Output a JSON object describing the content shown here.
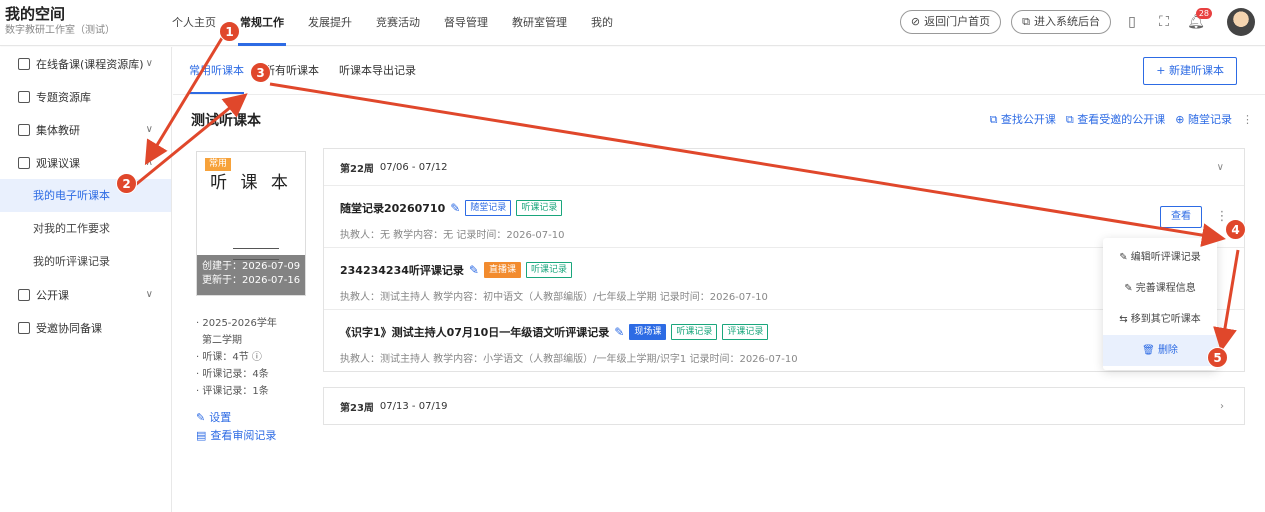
{
  "brand": {
    "title": "我的空间",
    "subtitle": "数字教研工作室（测试）"
  },
  "nav": [
    "个人主页",
    "常规工作",
    "发展提升",
    "竞赛活动",
    "督导管理",
    "教研室管理",
    "我的"
  ],
  "nav_active": "常规工作",
  "top_right": {
    "portal": "返回门户首页",
    "backend": "进入系统后台",
    "notif_count": "28"
  },
  "sidebar": {
    "items": [
      {
        "label": "在线备课(课程资源库)"
      },
      {
        "label": "专题资源库"
      },
      {
        "label": "集体教研"
      },
      {
        "label": "观课议课"
      }
    ],
    "sub": [
      "我的电子听课本",
      "对我的工作要求",
      "我的听评课记录"
    ],
    "items2": [
      {
        "label": "公开课"
      },
      {
        "label": "受邀协同备课"
      }
    ]
  },
  "tabs": [
    "常用听课本",
    "所有听课本",
    "听课本导出记录"
  ],
  "new_button": "+ 新建听课本",
  "book": {
    "title": "测试听课本",
    "tools": [
      "查找公开课",
      "查看受邀的公开课",
      "随堂记录"
    ],
    "cover": {
      "tag": "常用",
      "name": "听 课 本",
      "created": "创建于：2026-07-09",
      "updated": "更新于：2026-07-16"
    },
    "meta": [
      "· 2025-2026学年",
      "  第二学期",
      "· 听课：4节",
      "· 听课记录：4条",
      "· 评课记录：1条"
    ],
    "settings": "设置",
    "review": "查看审阅记录"
  },
  "weeks": [
    {
      "label": "第22周",
      "range": "07/06 - 07/12",
      "records": [
        {
          "title": "随堂记录20260710",
          "tags": [
            "随堂记录",
            "听课记录"
          ],
          "info": "执教人：无    教学内容：无    记录时间：2026-07-10"
        },
        {
          "title": "234234234听评课记录",
          "tags": [
            "直播课",
            "听课记录"
          ],
          "info": "执教人：测试主持人    教学内容：初中语文（人教部编版）/七年级上学期    记录时间：2026-07-10"
        },
        {
          "title": "《识字1》测试主持人07月10日一年级语文听评课记录",
          "tags": [
            "现场课",
            "听课记录",
            "评课记录"
          ],
          "info": "执教人：测试主持人    教学内容：小学语文（人教部编版）/一年级上学期/识字1    记录时间：2026-07-10"
        }
      ]
    },
    {
      "label": "第23周",
      "range": "07/13 - 07/19"
    }
  ],
  "view_button": "查看",
  "menu": [
    "编辑听评课记录",
    "完善课程信息",
    "移到其它听课本",
    "删除"
  ],
  "annotations": [
    "1",
    "2",
    "3",
    "4",
    "5"
  ]
}
